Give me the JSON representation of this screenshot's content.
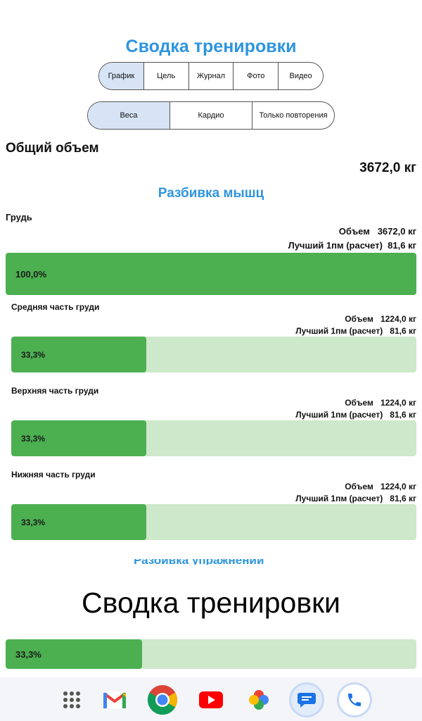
{
  "title": "Сводка тренировки",
  "tabs": [
    {
      "label": "График",
      "active": true
    },
    {
      "label": "Цель",
      "active": false
    },
    {
      "label": "Журнал",
      "active": false
    },
    {
      "label": "Фото",
      "active": false
    },
    {
      "label": "Видео",
      "active": false
    }
  ],
  "modes": [
    {
      "label": "Веса",
      "active": true
    },
    {
      "label": "Кардио",
      "active": false
    },
    {
      "label": "Только повторения",
      "active": false
    }
  ],
  "total": {
    "label": "Общий объем",
    "value": "3672,0 кг"
  },
  "breakdown_title": "Разбивка мышц",
  "group": {
    "name": "Грудь",
    "volume_label": "Объем",
    "volume": "3672,0 кг",
    "best_label": "Лучший 1пм (расчет)",
    "best": "81,6 кг",
    "percent_text": "100,0%",
    "fraction": 1.0
  },
  "muscles": [
    {
      "name": "Средняя часть груди",
      "volume_label": "Объем",
      "volume": "1224,0 кг",
      "best_label": "Лучший 1пм (расчет)",
      "best": "81,6 кг",
      "percent_text": "33,3%",
      "fraction": 0.333
    },
    {
      "name": "Верхняя часть груди",
      "volume_label": "Объем",
      "volume": "1224,0 кг",
      "best_label": "Лучший 1пм (расчет)",
      "best": "81,6 кг",
      "percent_text": "33,3%",
      "fraction": 0.333
    },
    {
      "name": "Нижняя часть груди",
      "volume_label": "Объем",
      "volume": "1224,0 кг",
      "best_label": "Лучший 1пм (расчет)",
      "best": "81,6 кг",
      "percent_text": "33,3%",
      "fraction": 0.333
    }
  ],
  "faded_heading": "Разбивка упражнений",
  "toast_text": "Сводка тренировки",
  "partial_bar": {
    "percent_text": "33,3%",
    "fraction": 0.333
  },
  "dock": [
    {
      "name": "app-drawer-icon"
    },
    {
      "name": "gmail-icon"
    },
    {
      "name": "chrome-icon"
    },
    {
      "name": "youtube-icon"
    },
    {
      "name": "photos-icon"
    },
    {
      "name": "messages-icon"
    },
    {
      "name": "phone-icon"
    }
  ],
  "colors": {
    "accent": "#2e95e0",
    "bar_fill": "#4caf50",
    "bar_track": "#cde8ca",
    "tab_active": "#d7e4f5"
  }
}
